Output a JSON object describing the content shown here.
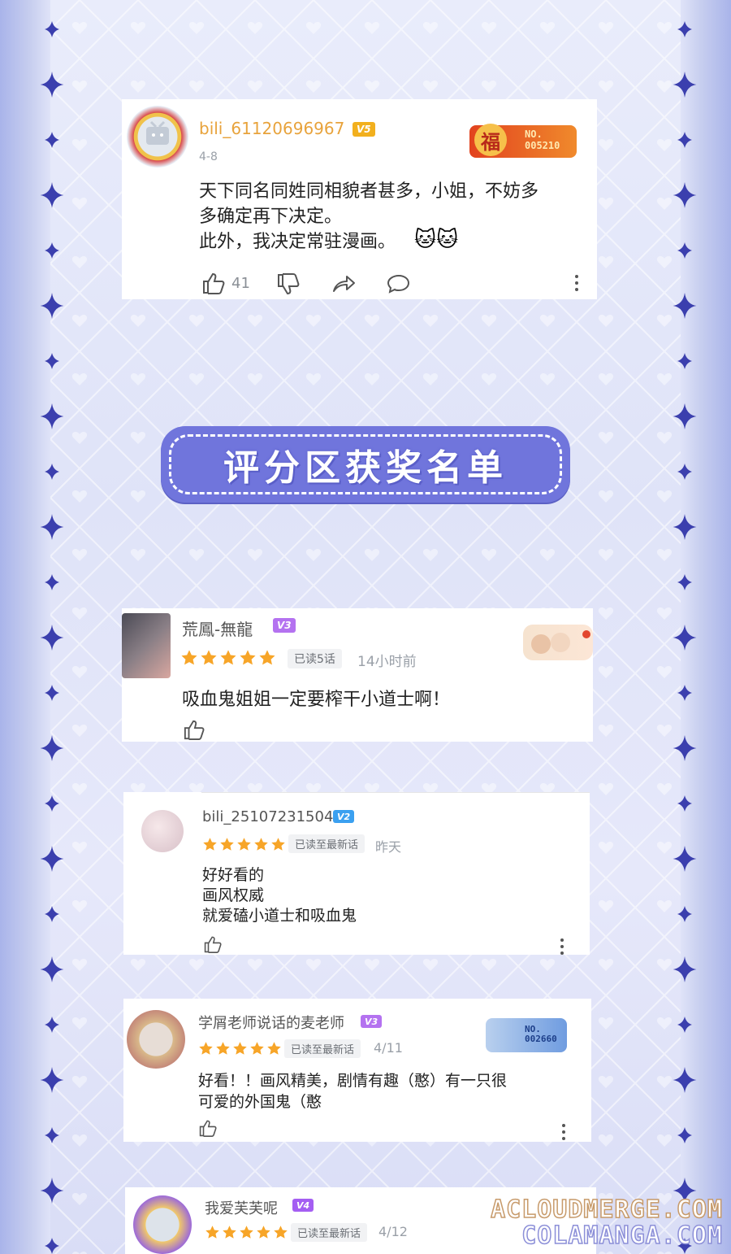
{
  "colors": {
    "accent_gold": "#e8a33c",
    "star": "#f7a528",
    "vip_v5": "#f2b01e",
    "vip_v3": "#b472f0",
    "vip_v2": "#3ba0f0",
    "vip_v4": "#a45ef2",
    "banner": "#7075dc"
  },
  "comment1": {
    "username": "bili_61120696967",
    "vip": "V5",
    "date": "4-8",
    "medal_text": "NO.\n005210",
    "body": "天下同名同姓同相貌者甚多，小姐，不妨多\n多确定再下决定。\n此外，我决定常驻漫画。",
    "emoji": "🐱🐱",
    "likes": "41"
  },
  "banner": {
    "title": "评分区获奖名单"
  },
  "review1": {
    "username": "荒鳳-無龍",
    "vip": "V3",
    "rating": 5,
    "read_tag": "已读5话",
    "time": "14小时前",
    "body": "吸血鬼姐姐一定要榨干小道士啊！"
  },
  "review2": {
    "username": "bili_25107231504",
    "vip": "V2",
    "rating": 5,
    "read_tag": "已读至最新话",
    "time": "昨天",
    "body": "好好看的\n画风权威\n就爱磕小道士和吸血鬼"
  },
  "review3": {
    "username": "学屑老师说话的麦老师",
    "vip": "V3",
    "rating": 5,
    "read_tag": "已读至最新话",
    "time": "4/11",
    "medal_text": "NO.\n002660",
    "body": "好看！！画风精美，剧情有趣（憨）有一只很\n可爱的外国鬼（憨"
  },
  "review4": {
    "username": "我爱芙芙呢",
    "vip": "V4",
    "rating": 5,
    "read_tag": "已读至最新话",
    "time": "4/12"
  },
  "watermark": {
    "line1": "ACLOUDMERGE.COM",
    "line2": "COLAMANGA.COM"
  }
}
